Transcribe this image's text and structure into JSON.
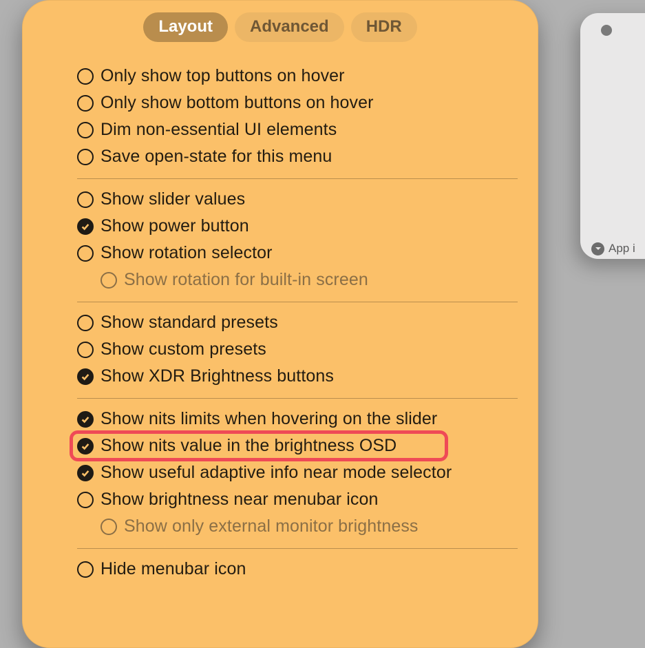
{
  "tabs": {
    "layout": "Layout",
    "advanced": "Advanced",
    "hdr": "HDR",
    "active": "layout"
  },
  "groups": [
    [
      {
        "id": "hover-top",
        "label": "Only show top buttons on hover",
        "checked": false
      },
      {
        "id": "hover-bottom",
        "label": "Only show bottom buttons on hover",
        "checked": false
      },
      {
        "id": "dim-ui",
        "label": "Dim non-essential UI elements",
        "checked": false
      },
      {
        "id": "save-state",
        "label": "Save open-state for this menu",
        "checked": false
      }
    ],
    [
      {
        "id": "slider-values",
        "label": "Show slider values",
        "checked": false
      },
      {
        "id": "power-button",
        "label": "Show power button",
        "checked": true
      },
      {
        "id": "rotation-sel",
        "label": "Show rotation selector",
        "checked": false
      },
      {
        "id": "rotation-builtin",
        "label": "Show rotation for built-in screen",
        "checked": false,
        "sub": true,
        "disabled": true
      }
    ],
    [
      {
        "id": "std-presets",
        "label": "Show standard presets",
        "checked": false
      },
      {
        "id": "cust-presets",
        "label": "Show custom presets",
        "checked": false
      },
      {
        "id": "xdr-buttons",
        "label": "Show XDR Brightness buttons",
        "checked": true
      }
    ],
    [
      {
        "id": "nits-hover",
        "label": "Show nits limits when hovering on the slider",
        "checked": true
      },
      {
        "id": "nits-osd",
        "label": "Show nits value in the brightness OSD",
        "checked": true,
        "highlight": true
      },
      {
        "id": "adaptive-info",
        "label": "Show useful adaptive info near mode selector",
        "checked": true
      },
      {
        "id": "brightness-menubar",
        "label": "Show brightness near menubar icon",
        "checked": false
      },
      {
        "id": "ext-only",
        "label": "Show only external monitor brightness",
        "checked": false,
        "sub": true,
        "disabled": true
      }
    ],
    [
      {
        "id": "hide-menubar",
        "label": "Hide menubar icon",
        "checked": false
      }
    ]
  ],
  "side": {
    "footer": "App i"
  }
}
